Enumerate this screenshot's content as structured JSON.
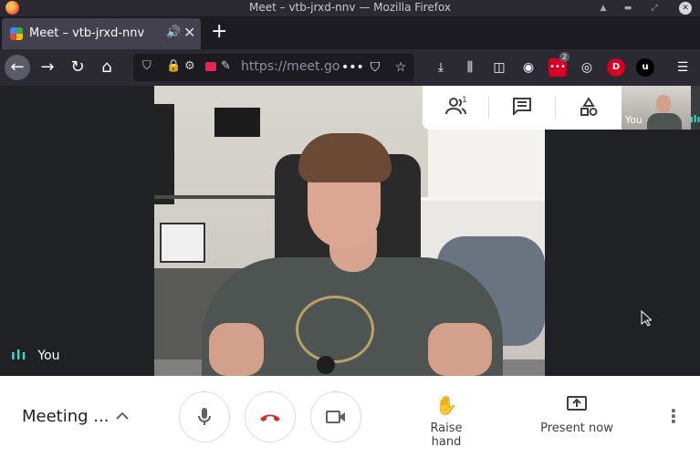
{
  "window": {
    "title": "Meet – vtb-jrxd-nnv — Mozilla Firefox",
    "controls": [
      "▲",
      "▬",
      "⤢",
      "✕"
    ]
  },
  "tab": {
    "title": "Meet – vtb-jrxd-nnv",
    "audio_icon": "🔊",
    "close": "✕",
    "new_tab": "+"
  },
  "navbar": {
    "back": "←",
    "forward": "→",
    "reload": "↻",
    "home": "⌂",
    "url": "https://meet.go",
    "more": "•••",
    "extension_badge": "2",
    "ext_d_label": "D",
    "ext_u_label": "u",
    "menu": "☰"
  },
  "video": {
    "participant_label": "You",
    "audio_bars": "ılı"
  },
  "panel": {
    "people_count": "1",
    "people_icon": "people-icon",
    "chat_icon": "chat-icon",
    "activities_icon": "activities-icon"
  },
  "self_view": {
    "label": "You",
    "audio_bars": "ılı"
  },
  "bottom": {
    "meeting_title": "Meeting ...",
    "details_chevron": "^",
    "mic_icon": "🎤",
    "hangup_icon": "☎",
    "camera_icon": "▭",
    "raise_hand_icon": "✋",
    "raise_hand_label": "Raise hand",
    "present_icon": "⬆",
    "present_label": "Present now",
    "more_icon": "⋮"
  },
  "colors": {
    "accent_teal": "#42d7c6",
    "hangup_red": "#d93025",
    "firefox_dark": "#1c1b22",
    "firefox_chrome": "#2b2a33"
  }
}
